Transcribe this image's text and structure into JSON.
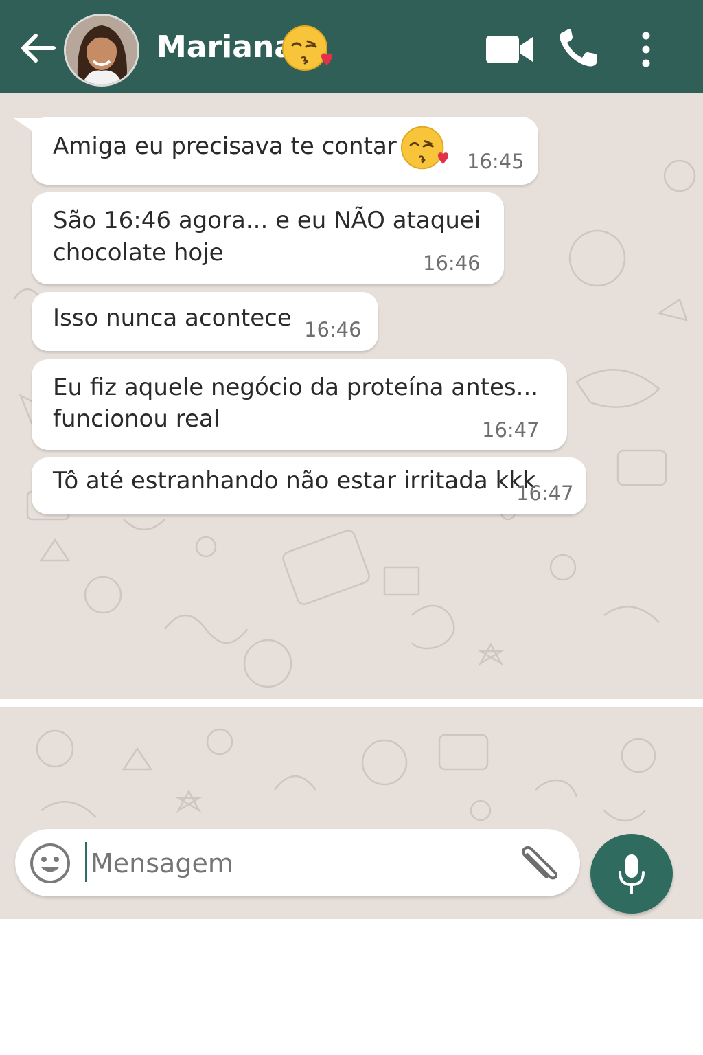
{
  "header": {
    "contact_name": "Mariana",
    "back_icon": "arrow-left-icon",
    "avatar": "contact-avatar",
    "name_emoji": "face-blowing-kiss-emoji",
    "icons": [
      "video-camera-icon",
      "phone-icon",
      "kebab-menu-icon"
    ]
  },
  "messages": [
    {
      "text_lines": [
        "Amiga eu precisava te contar"
      ],
      "emoji": "face-blowing-kiss-emoji",
      "time": "16:45"
    },
    {
      "text_lines": [
        "São 16:46 agora... e eu NÃO ataquei",
        "chocolate hoje"
      ],
      "time": "16:46"
    },
    {
      "text_lines": [
        "Isso nunca acontece"
      ],
      "time": "16:46"
    },
    {
      "text_lines": [
        "Eu fiz aquele negócio da proteína antes...",
        "funcionou real"
      ],
      "time": "16:47"
    },
    {
      "text_lines": [
        "Tô até estranhando não estar irritada kkk"
      ],
      "time": "16:47"
    }
  ],
  "composer": {
    "placeholder": "Mensagem",
    "emoji_icon": "smiley-icon",
    "attach_icon": "paperclip-icon",
    "mic_icon": "microphone-icon"
  },
  "colors": {
    "header": "#2f5f57",
    "wallpaper": "#e7e0da",
    "bubble": "#ffffff",
    "mic_button": "#2f6b5f"
  }
}
